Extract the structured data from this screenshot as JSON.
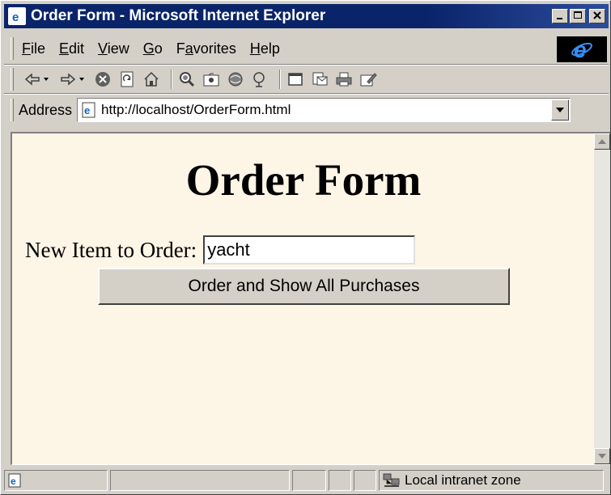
{
  "window": {
    "title": "Order Form - Microsoft Internet Explorer",
    "controls": [
      "minimize",
      "maximize",
      "close"
    ]
  },
  "menu": {
    "items": [
      {
        "label": "File",
        "accel": "F"
      },
      {
        "label": "Edit",
        "accel": "E"
      },
      {
        "label": "View",
        "accel": "V"
      },
      {
        "label": "Go",
        "accel": "G"
      },
      {
        "label": "Favorites",
        "accel": "a"
      },
      {
        "label": "Help",
        "accel": "H"
      }
    ]
  },
  "toolbar": {
    "icons": [
      "back-icon",
      "forward-icon",
      "stop-icon",
      "refresh-icon",
      "home-icon",
      "search-icon",
      "favorites-icon",
      "history-icon",
      "channels-icon",
      "fullscreen-icon",
      "mail-icon",
      "print-icon",
      "edit-icon"
    ]
  },
  "address": {
    "label": "Address",
    "url": "http://localhost/OrderForm.html"
  },
  "page": {
    "title": "Order Form",
    "field_label": "New Item to Order:",
    "field_value": "yacht",
    "button_label": "Order and Show All Purchases"
  },
  "status": {
    "zone": "Local intranet zone"
  },
  "colors": {
    "titlebar": "#0a246a",
    "page_background": "#fdf5e6",
    "chrome": "#d4d0c8"
  }
}
